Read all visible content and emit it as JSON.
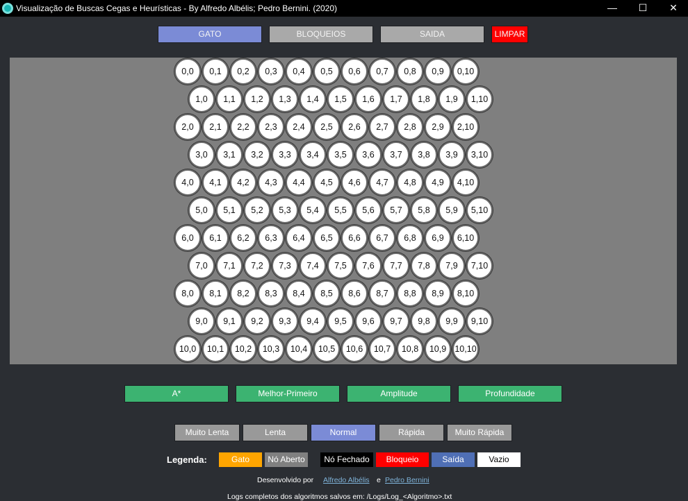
{
  "window": {
    "title": "Visualização de Buscas Cegas e Heurísticas - By Alfredo Albélis; Pedro Bernini. (2020)",
    "controls": {
      "minimize": "—",
      "maximize": "☐",
      "close": "✕"
    }
  },
  "toolbar": {
    "gato": "GATO",
    "bloqueios": "BLOQUEIOS",
    "saida": "SAIDA",
    "limpar": "LIMPAR"
  },
  "grid": {
    "rows": 11,
    "cols": 11
  },
  "algorithms": {
    "astar": "A*",
    "best_first": "Melhor-Primeiro",
    "breadth": "Amplitude",
    "depth": "Profundidade"
  },
  "speeds": {
    "very_slow": "Muito Lenta",
    "slow": "Lenta",
    "normal": "Normal",
    "fast": "Rápida",
    "very_fast": "Muito Rápida",
    "selected": "Normal"
  },
  "legend": {
    "label": "Legenda:",
    "gato": "Gato",
    "no_aberto": "Nó Aberto",
    "no_fechado": "Nó Fechado",
    "bloqueio": "Bloqueio",
    "saida": "Saída",
    "vazio": "Vazio"
  },
  "footer": {
    "developed_by": "Desenvolvido por",
    "author1": "Alfredo Albélis",
    "conj": "e",
    "author2": "Pedro Bernini",
    "logs": "Logs completos dos algoritmos salvos em: /Logs/Log_<Algoritmo>.txt"
  },
  "colors": {
    "gato": "#7b8bd6",
    "bloqueios": "#a9a9a9",
    "saida": "#a9a9a9",
    "limpar": "#ff0000",
    "algorithm": "#3cb371",
    "speed": "#999999",
    "speed_selected": "#7b8bd6",
    "legend_gato": "#ffa500",
    "legend_no_aberto": "#808080",
    "legend_no_fechado": "#000000",
    "legend_bloqueio": "#ff0000",
    "legend_saida": "#4f6fb5",
    "legend_vazio": "#ffffff"
  }
}
